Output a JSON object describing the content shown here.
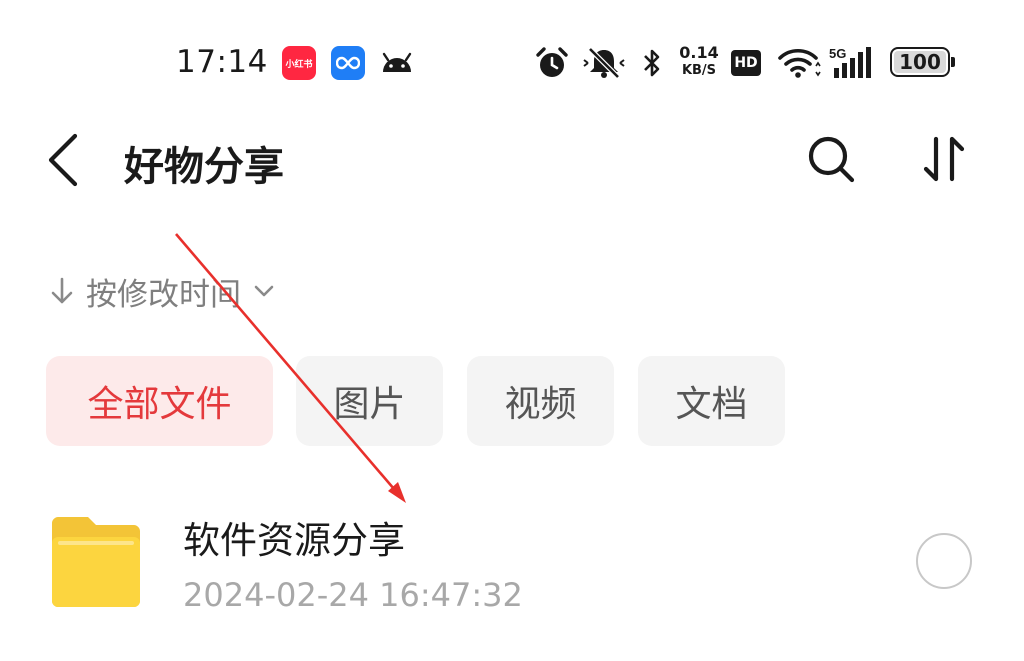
{
  "status_bar": {
    "time": "17:14",
    "app_badges": [
      "xiaohongshu-icon",
      "loop-app-icon",
      "android-icon"
    ],
    "xhs_badge_text": "小红书",
    "net_speed_value": "0.14",
    "net_speed_unit": "KB/S",
    "hd_label": "HD",
    "network_label": "5G",
    "battery_level": "100",
    "icons": [
      "alarm-icon",
      "mute-bell-icon",
      "bluetooth-icon",
      "wifi-icon",
      "signal-icon",
      "battery-icon"
    ]
  },
  "header": {
    "title": "好物分享",
    "back_icon": "back-chevron-icon",
    "search_icon": "search-icon",
    "sort_icon": "sort-icon"
  },
  "sort": {
    "label": "按修改时间",
    "direction_icon": "arrow-down-icon",
    "dropdown_icon": "chevron-down-icon"
  },
  "filter_tabs": [
    {
      "label": "全部文件",
      "active": true
    },
    {
      "label": "图片",
      "active": false
    },
    {
      "label": "视频",
      "active": false
    },
    {
      "label": "文档",
      "active": false
    }
  ],
  "files": [
    {
      "name": "软件资源分享",
      "date": "2024-02-24 16:47:32",
      "type_icon": "folder-icon",
      "selected": false
    }
  ],
  "colors": {
    "accent": "#e4393c",
    "active_tab_bg": "#fdeaea",
    "inactive_tab_bg": "#f4f4f4",
    "folder": "#fcd53f",
    "annotation_arrow": "#e8302c"
  }
}
